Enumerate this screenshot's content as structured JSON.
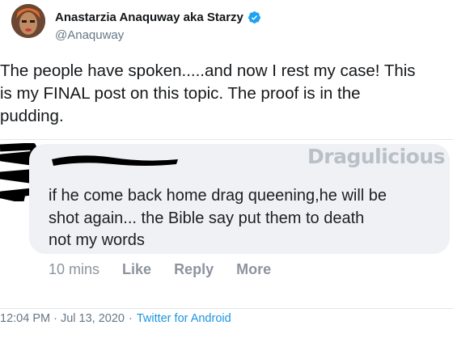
{
  "author": {
    "display_name": "Anastarzia Anaquway aka Starzy",
    "handle": "@Anaquway",
    "verified": true
  },
  "tweet": {
    "text": "The people have spoken.....and now I rest my case! This\nis my FINAL post on this topic. The proof is in the\npudding."
  },
  "embedded_comment": {
    "watermark": "Dragulicious",
    "text": "if he come back home drag queening,he will be\nshot again... the Bible say put them to death\nnot my words",
    "time": "10 mins",
    "actions": [
      "Like",
      "Reply",
      "More"
    ]
  },
  "meta": {
    "timestamp": "12:04 PM · Jul 13, 2020",
    "separator": "·",
    "source": "Twitter for Android"
  },
  "colors": {
    "verified_badge": "#1da1f2",
    "link": "#1b95e0",
    "bubble": "#eff1f4"
  }
}
